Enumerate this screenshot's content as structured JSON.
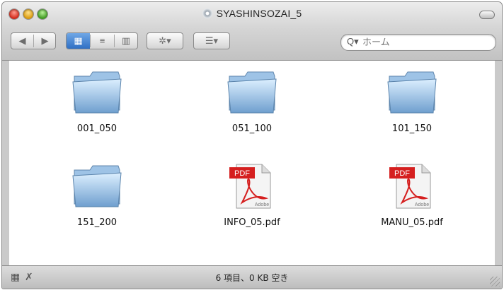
{
  "window": {
    "title": "SYASHINSOZAI_5",
    "title_icon": "disc-icon"
  },
  "toolbar": {
    "back_label": "◀",
    "forward_label": "▶",
    "view_icons_label": "▦",
    "view_list_label": "≡",
    "view_columns_label": "▥",
    "action_label": "✲▾",
    "arrange_label": "☰▾",
    "search_placeholder": "ホーム"
  },
  "items": [
    {
      "name": "001_050",
      "type": "folder"
    },
    {
      "name": "051_100",
      "type": "folder"
    },
    {
      "name": "101_150",
      "type": "folder"
    },
    {
      "name": "151_200",
      "type": "folder"
    },
    {
      "name": "INFO_05.pdf",
      "type": "pdf"
    },
    {
      "name": "MANU_05.pdf",
      "type": "pdf"
    }
  ],
  "pdf_badge": "PDF",
  "pdf_brand": "Adobe",
  "status": {
    "text": "6 項目、0 KB 空き"
  },
  "colors": {
    "folder_light": "#d9ecff",
    "folder_dark": "#6c99c6",
    "pdf_red": "#d51f1f",
    "selection_blue": "#2f6fc4"
  }
}
